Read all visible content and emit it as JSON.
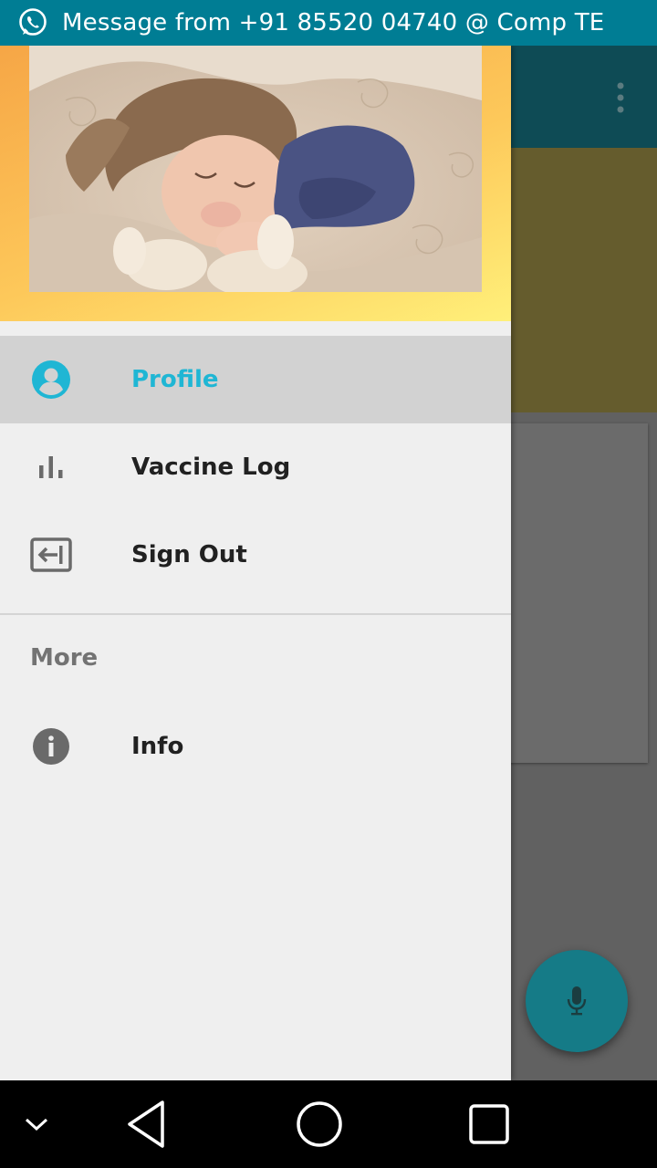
{
  "status_bar": {
    "notification_icon": "whatsapp-icon",
    "message": "Message from +91 85520 04740 @ Comp TE"
  },
  "drawer": {
    "header_image": "sleeping-child-photo",
    "items": [
      {
        "label": "Profile",
        "icon": "account-circle-icon",
        "active": true
      },
      {
        "label": "Vaccine Log",
        "icon": "bar-chart-icon",
        "active": false
      },
      {
        "label": "Sign Out",
        "icon": "sign-out-icon",
        "active": false
      }
    ],
    "section_header": "More",
    "more_items": [
      {
        "label": "Info",
        "icon": "info-icon"
      }
    ]
  },
  "background": {
    "overflow_icon": "overflow-menu-icon",
    "fab_icon": "microphone-icon"
  },
  "nav_bar": {
    "items": [
      "chevron-down-icon",
      "back-icon",
      "home-icon",
      "recents-icon"
    ]
  },
  "colors": {
    "status_bar": "#007d94",
    "accent": "#1fb6d4",
    "drawer_bg": "#efefef",
    "active_bg": "#d2d2d2"
  }
}
